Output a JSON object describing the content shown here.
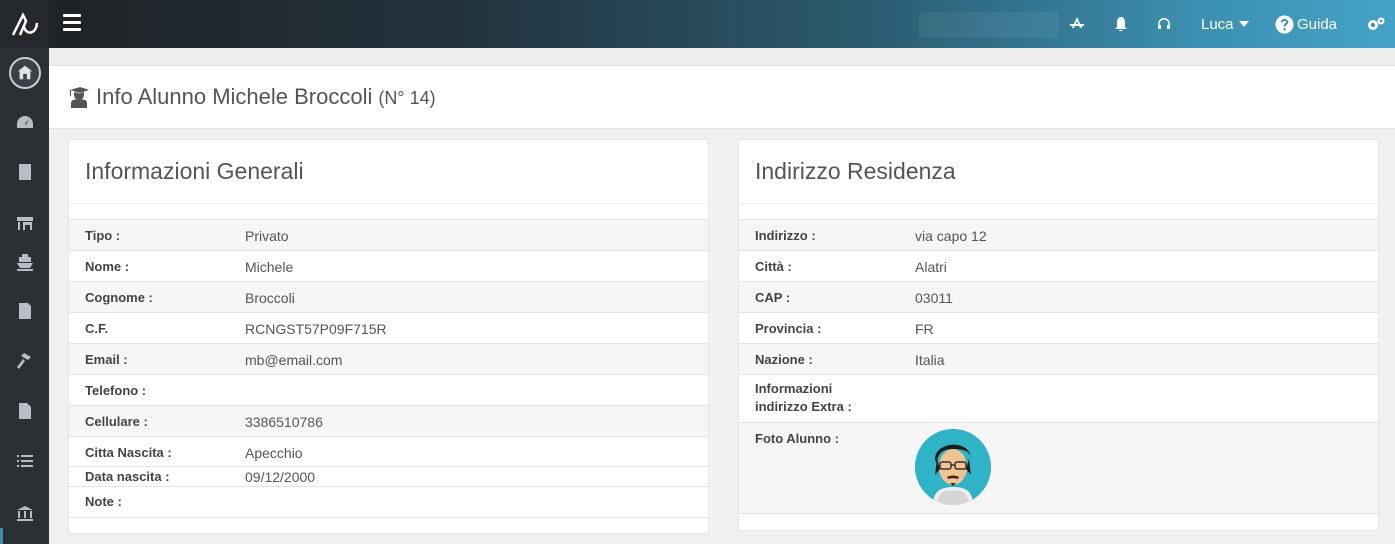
{
  "topbar": {
    "user": "Luca",
    "guide": "Guida"
  },
  "page": {
    "title": "Info Alunno Michele Broccoli",
    "number": "(N° 14)"
  },
  "general": {
    "title": "Informazioni Generali",
    "rows": [
      {
        "label": "Tipo :",
        "value": "Privato"
      },
      {
        "label": "Nome :",
        "value": "Michele"
      },
      {
        "label": "Cognome :",
        "value": "Broccoli"
      },
      {
        "label": "C.F.",
        "value": "RCNGST57P09F715R"
      },
      {
        "label": "Email :",
        "value": "mb@email.com"
      },
      {
        "label": "Telefono :",
        "value": ""
      },
      {
        "label": "Cellulare :",
        "value": "3386510786"
      },
      {
        "label": "Citta Nascita :",
        "value": "Apecchio"
      },
      {
        "label": "Data nascita :",
        "value": "09/12/2000"
      },
      {
        "label": "Note :",
        "value": ""
      }
    ]
  },
  "address": {
    "title": "Indirizzo Residenza",
    "rows": [
      {
        "label": "Indirizzo :",
        "value": "via capo 12"
      },
      {
        "label": "Città :",
        "value": "Alatri"
      },
      {
        "label": "CAP :",
        "value": "03011"
      },
      {
        "label": "Provincia :",
        "value": "FR"
      },
      {
        "label": "Nazione :",
        "value": "Italia"
      },
      {
        "label": "Informazioni indirizzo Extra :",
        "value": ""
      },
      {
        "label": "Foto Alunno :",
        "value": ""
      }
    ]
  },
  "sidebar": {
    "icons": [
      "logo-icon",
      "school-icon",
      "dashboard-icon",
      "book-icon",
      "store-icon",
      "ship-icon",
      "receipt-icon",
      "hammer-icon",
      "document-icon",
      "list-icon",
      "bank-icon"
    ]
  }
}
